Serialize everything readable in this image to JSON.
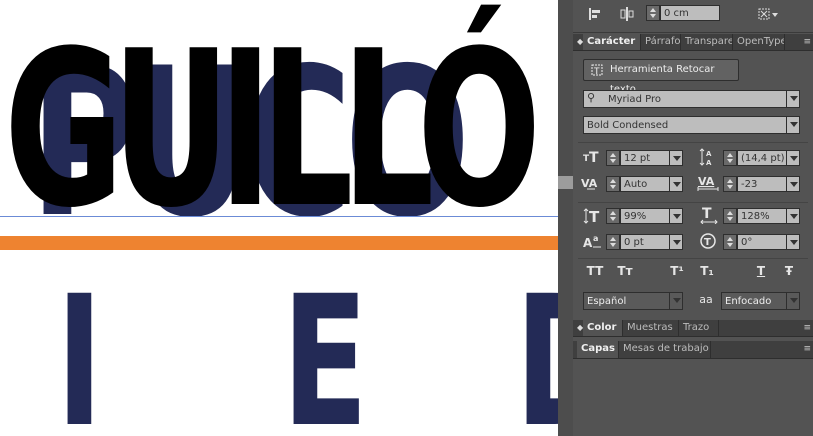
{
  "canvas": {
    "upper_word_navy": "PUCO",
    "upper_word_black": "GUILLÓ",
    "lower_letters": [
      "I",
      "E",
      "D"
    ],
    "colors": {
      "navy": "#232a56",
      "orange": "#ee8330",
      "black": "#000000",
      "guide": "#6b8bd6"
    }
  },
  "panel": {
    "topbar": {
      "offset_value": "0 cm",
      "icons": [
        "align-icon",
        "distribute-icon",
        "transform-icon"
      ]
    },
    "character_tabs": [
      {
        "label": "Carácter",
        "active": true
      },
      {
        "label": "Párrafo",
        "active": false
      },
      {
        "label": "Transpare",
        "active": false
      },
      {
        "label": "OpenType",
        "active": false
      }
    ],
    "touch_type_label": "Herramienta Retocar texto",
    "font_family": "Myriad Pro",
    "font_style": "Bold Condensed",
    "font_size": "12 pt",
    "leading": "(14,4 pt)",
    "kerning": "Auto",
    "tracking": "-23",
    "vertical_scale": "99%",
    "horizontal_scale": "128%",
    "baseline_shift": "0 pt",
    "rotation": "0°",
    "style_buttons": [
      "TT",
      "Tт",
      "T¹",
      "T₁",
      "T",
      "Ŧ"
    ],
    "language": "Español",
    "antialias": "Enfocado",
    "antialias_icon_text": "aa",
    "color_tabs": [
      {
        "label": "Color",
        "active": true
      },
      {
        "label": "Muestras",
        "active": false
      },
      {
        "label": "Trazo",
        "active": false
      }
    ],
    "layers_tabs": [
      {
        "label": "Capas",
        "active": true
      },
      {
        "label": "Mesas de trabajo",
        "active": false
      }
    ]
  }
}
